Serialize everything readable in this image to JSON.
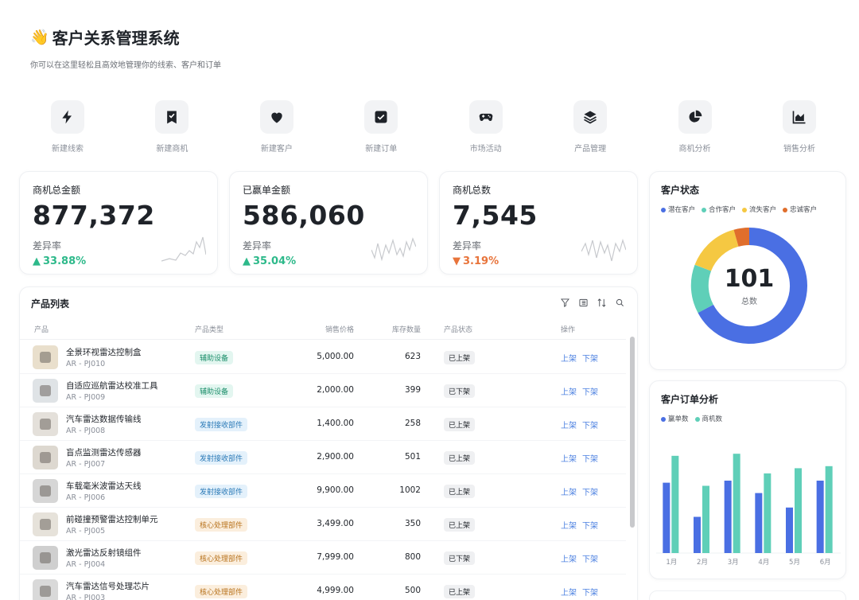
{
  "header": {
    "emoji": "👋",
    "title": "客户关系管理系统",
    "subtitle": "你可以在这里轻松且高效地管理你的线索、客户和订单"
  },
  "quick_actions": [
    {
      "label": "新建线索",
      "icon": "lightning-icon"
    },
    {
      "label": "新建商机",
      "icon": "bookmark-check-icon"
    },
    {
      "label": "新建客户",
      "icon": "heart-icon"
    },
    {
      "label": "新建订单",
      "icon": "checkbox-icon"
    },
    {
      "label": "市场活动",
      "icon": "gamepad-icon"
    },
    {
      "label": "产品管理",
      "icon": "layers-icon"
    },
    {
      "label": "商机分析",
      "icon": "pie-chart-icon"
    },
    {
      "label": "销售分析",
      "icon": "area-chart-icon"
    }
  ],
  "stats": [
    {
      "label": "商机总金额",
      "value": "877,372",
      "rate_label": "差异率",
      "rate": "33.88%",
      "trend": "up"
    },
    {
      "label": "已赢单金额",
      "value": "586,060",
      "rate_label": "差异率",
      "rate": "35.04%",
      "trend": "up"
    },
    {
      "label": "商机总数",
      "value": "7,545",
      "rate_label": "差异率",
      "rate": "3.19%",
      "trend": "down"
    }
  ],
  "products": {
    "title": "产品列表",
    "columns": [
      "产品",
      "产品类型",
      "销售价格",
      "库存数量",
      "产品状态",
      "操作"
    ],
    "actions": {
      "on": "上架",
      "off": "下架"
    },
    "rows": [
      {
        "name": "全景环视雷达控制盒",
        "code": "AR - PJ010",
        "type": "辅助设备",
        "price": "5,000.00",
        "stock": "623",
        "status": "已上架"
      },
      {
        "name": "自适应巡航雷达校准工具",
        "code": "AR - PJ009",
        "type": "辅助设备",
        "price": "2,000.00",
        "stock": "399",
        "status": "已下架"
      },
      {
        "name": "汽车雷达数据传输线",
        "code": "AR - PJ008",
        "type": "发射接收部件",
        "price": "1,400.00",
        "stock": "258",
        "status": "已上架"
      },
      {
        "name": "盲点监测雷达传感器",
        "code": "AR - PJ007",
        "type": "发射接收部件",
        "price": "2,900.00",
        "stock": "501",
        "status": "已上架"
      },
      {
        "name": "车载毫米波雷达天线",
        "code": "AR - PJ006",
        "type": "发射接收部件",
        "price": "9,900.00",
        "stock": "1002",
        "status": "已上架"
      },
      {
        "name": "前碰撞预警雷达控制单元",
        "code": "AR - PJ005",
        "type": "核心处理部件",
        "price": "3,499.00",
        "stock": "350",
        "status": "已上架"
      },
      {
        "name": "激光雷达反射镜组件",
        "code": "AR - PJ004",
        "type": "核心处理部件",
        "price": "7,999.00",
        "stock": "800",
        "status": "已下架"
      },
      {
        "name": "汽车雷达信号处理芯片",
        "code": "AR - PJ003",
        "type": "核心处理部件",
        "price": "4,999.00",
        "stock": "500",
        "status": "已上架"
      }
    ]
  },
  "customer_status": {
    "title": "客户状态",
    "total": "101",
    "total_label": "总数",
    "legend": [
      "潜在客户",
      "合作客户",
      "流失客户",
      "忠诚客户"
    ],
    "colors": [
      "#4a6fe3",
      "#5fcfb8",
      "#f5c842",
      "#e06e2c"
    ]
  },
  "chart_data": {
    "type": "bar",
    "title": "客户订单分析",
    "categories": [
      "1月",
      "2月",
      "3月",
      "4月",
      "5月",
      "6月"
    ],
    "series": [
      {
        "name": "赢单数",
        "values": [
          68,
          35,
          70,
          58,
          44,
          70
        ],
        "color": "#4a6fe3"
      },
      {
        "name": "商机数",
        "values": [
          94,
          65,
          96,
          77,
          82,
          84
        ],
        "color": "#5fcfb8"
      }
    ],
    "ylim": [
      0,
      120
    ]
  }
}
